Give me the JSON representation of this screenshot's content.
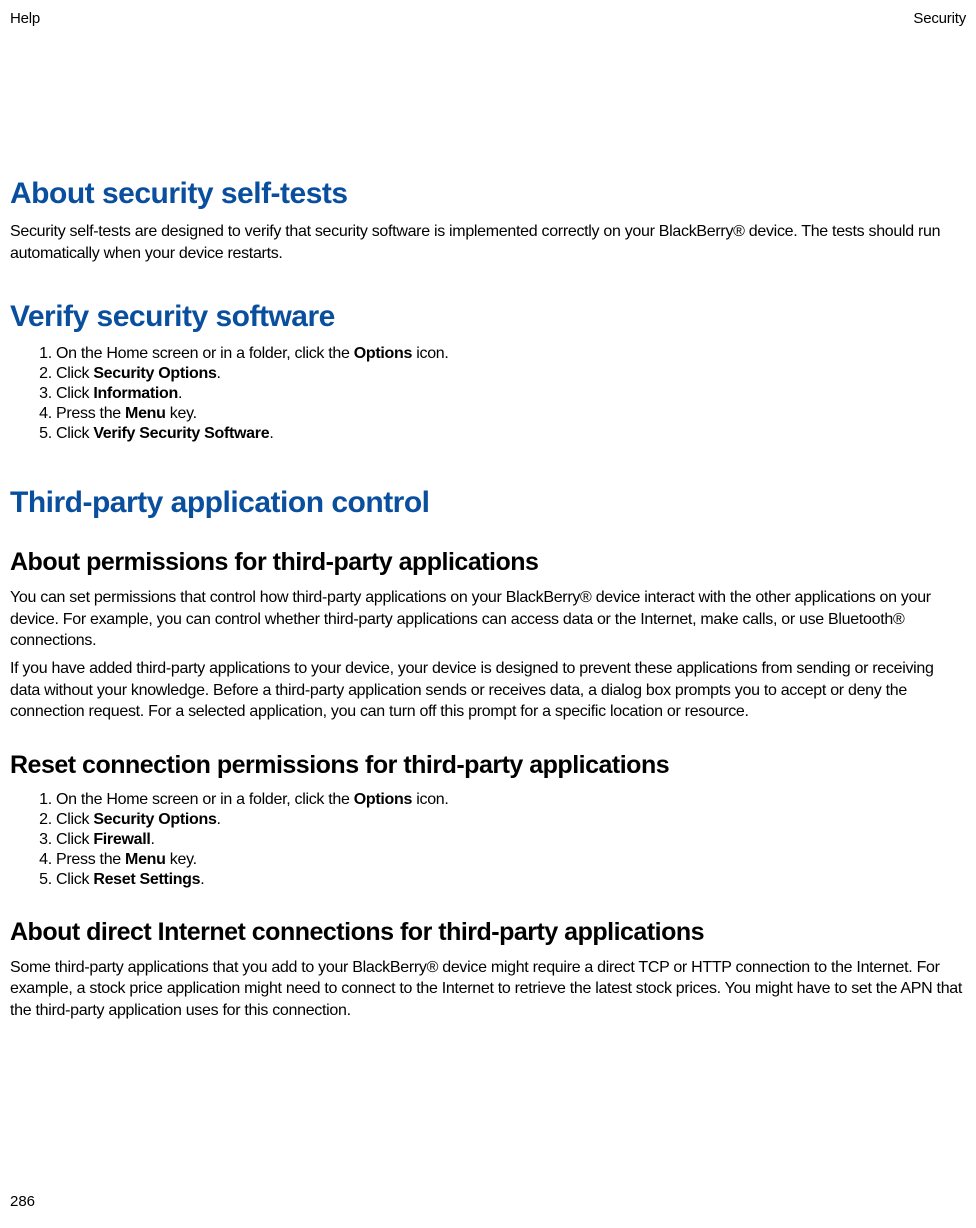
{
  "header": {
    "left": "Help",
    "right": "Security"
  },
  "footer": {
    "page": "286"
  },
  "sec1": {
    "title": "About security self-tests",
    "p1": "Security self-tests are designed to verify that security software is implemented correctly on your BlackBerry® device. The tests should run automatically when your device restarts."
  },
  "sec2": {
    "title": "Verify security software",
    "steps": {
      "s1a": "On the Home screen or in a folder, click the ",
      "s1b": "Options",
      "s1c": " icon.",
      "s2a": "Click ",
      "s2b": "Security Options",
      "s2c": ".",
      "s3a": "Click ",
      "s3b": "Information",
      "s3c": ".",
      "s4a": "Press the ",
      "s4b": "Menu",
      "s4c": " key.",
      "s5a": "Click ",
      "s5b": "Verify Security Software",
      "s5c": "."
    }
  },
  "sec3": {
    "title": "Third-party application control"
  },
  "sec4": {
    "title": "About permissions for third-party applications",
    "p1": "You can set permissions that control how third-party applications on your BlackBerry® device interact with the other applications on your device. For example, you can control whether third-party applications can access data or the Internet, make calls, or use Bluetooth® connections.",
    "p2": "If you have added third-party applications to your device, your device is designed to prevent these applications from sending or receiving data without your knowledge. Before a third-party application sends or receives data, a dialog box prompts you to accept or deny the connection request. For a selected application, you can turn off this prompt for a specific location or resource."
  },
  "sec5": {
    "title": "Reset connection permissions for third-party applications",
    "steps": {
      "s1a": "On the Home screen or in a folder, click the ",
      "s1b": "Options",
      "s1c": " icon.",
      "s2a": "Click ",
      "s2b": "Security Options",
      "s2c": ".",
      "s3a": "Click ",
      "s3b": "Firewall",
      "s3c": ".",
      "s4a": "Press the ",
      "s4b": "Menu",
      "s4c": " key.",
      "s5a": "Click ",
      "s5b": "Reset Settings",
      "s5c": "."
    }
  },
  "sec6": {
    "title": "About direct Internet connections for third-party applications",
    "p1": "Some third-party applications that you add to your BlackBerry® device might require a direct TCP or HTTP connection to the Internet. For example, a stock price application might need to connect to the Internet to retrieve the latest stock prices. You might have to set the APN that the third-party application uses for this connection."
  }
}
